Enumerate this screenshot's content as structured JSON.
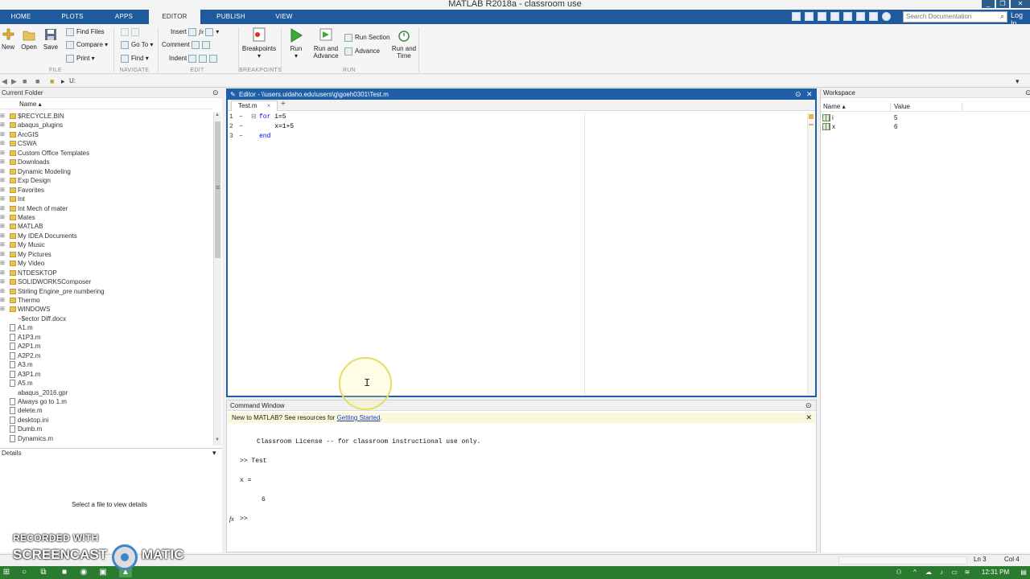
{
  "window": {
    "title": "MATLAB R2018a - classroom use",
    "controls": [
      "_",
      "❐",
      "✕"
    ]
  },
  "ribbon_tabs": [
    {
      "label": "HOME",
      "active": false
    },
    {
      "label": "PLOTS",
      "active": false
    },
    {
      "label": "APPS",
      "active": false
    },
    {
      "label": "EDITOR",
      "active": true
    },
    {
      "label": "PUBLISH",
      "active": false
    },
    {
      "label": "VIEW",
      "active": false
    }
  ],
  "search": {
    "placeholder": "Search Documentation"
  },
  "login_label": "Log In",
  "ribbon": {
    "file": {
      "group": "FILE",
      "new": "New",
      "open": "Open",
      "save": "Save",
      "find_files": "Find Files",
      "compare": "Compare",
      "print": "Print"
    },
    "navigate": {
      "group": "NAVIGATE",
      "goto": "Go To",
      "find": "Find"
    },
    "edit": {
      "group": "EDIT",
      "insert": "Insert",
      "comment": "Comment",
      "indent": "Indent",
      "fx": "fx"
    },
    "breakpoints": {
      "group": "BREAKPOINTS",
      "breakpoints": "Breakpoints"
    },
    "run": {
      "group": "RUN",
      "run": "Run",
      "run_and_advance": "Run and Advance",
      "run_section": "Run Section",
      "advance": "Advance",
      "run_and_time": "Run and Time"
    }
  },
  "address": {
    "path": "U:"
  },
  "current_folder": {
    "title": "Current Folder",
    "column": "Name",
    "items": [
      {
        "name": "$RECYCLE.BIN",
        "type": "folder"
      },
      {
        "name": "abaqus_plugins",
        "type": "folder"
      },
      {
        "name": "ArcGIS",
        "type": "folder"
      },
      {
        "name": "CSWA",
        "type": "folder"
      },
      {
        "name": "Custom Office Templates",
        "type": "folder"
      },
      {
        "name": "Downloads",
        "type": "folder"
      },
      {
        "name": "Dynamic Modeling",
        "type": "folder"
      },
      {
        "name": "Exp Design",
        "type": "folder"
      },
      {
        "name": "Favorites",
        "type": "folder"
      },
      {
        "name": "Int",
        "type": "folder"
      },
      {
        "name": "Int Mech of mater",
        "type": "folder"
      },
      {
        "name": "Mates",
        "type": "folder"
      },
      {
        "name": "MATLAB",
        "type": "folder"
      },
      {
        "name": "My IDEA Documents",
        "type": "folder"
      },
      {
        "name": "My Music",
        "type": "folder"
      },
      {
        "name": "My Pictures",
        "type": "folder"
      },
      {
        "name": "My Video",
        "type": "folder"
      },
      {
        "name": "NTDESKTOP",
        "type": "folder"
      },
      {
        "name": "SOLIDWORKSComposer",
        "type": "folder"
      },
      {
        "name": "Stirling Engine_pre numbering",
        "type": "folder"
      },
      {
        "name": "Thermo",
        "type": "folder"
      },
      {
        "name": "WINDOWS",
        "type": "folder"
      },
      {
        "name": "~$ector Diff.docx",
        "type": "file"
      },
      {
        "name": "A1.m",
        "type": "mfile"
      },
      {
        "name": "A1P3.m",
        "type": "mfile"
      },
      {
        "name": "A2P1.m",
        "type": "mfile"
      },
      {
        "name": "A2P2.m",
        "type": "mfile"
      },
      {
        "name": "A3.m",
        "type": "mfile"
      },
      {
        "name": "A3P1.m",
        "type": "mfile"
      },
      {
        "name": "A5.m",
        "type": "mfile"
      },
      {
        "name": "abaqus_2016.gpr",
        "type": "file"
      },
      {
        "name": "Always go to 1.m",
        "type": "mfile"
      },
      {
        "name": "delete.m",
        "type": "mfile"
      },
      {
        "name": "desktop.ini",
        "type": "mfile"
      },
      {
        "name": "Dumb.m",
        "type": "mfile"
      },
      {
        "name": "Dynamics.m",
        "type": "mfile"
      }
    ]
  },
  "details": {
    "title": "Details",
    "message": "Select a file to view details"
  },
  "editor": {
    "title": "Editor - \\\\users.uidaho.edu\\users\\g\\goeh0301\\Test.m",
    "tabs": [
      {
        "label": "Test.m",
        "close": "×"
      }
    ],
    "add_tab": "+",
    "lines": [
      {
        "num": "1",
        "pre": "",
        "kw": "for",
        "rest": " i=5"
      },
      {
        "num": "2",
        "pre": "    ",
        "kw": "",
        "rest": "x=1+5"
      },
      {
        "num": "3",
        "pre": "",
        "kw": "end",
        "rest": ""
      }
    ]
  },
  "command_window": {
    "title": "Command Window",
    "banner_prefix": "New to MATLAB? See resources for ",
    "banner_link": "Getting Started",
    "banner_suffix": ".",
    "license": "Classroom License -- for classroom instructional use only.",
    "cmd": ">> Test",
    "var_out": "x =",
    "value_out": "6",
    "fx": "fx",
    "prompt": ">>"
  },
  "workspace": {
    "title": "Workspace",
    "col_name": "Name",
    "col_value": "Value",
    "vars": [
      {
        "name": "i",
        "value": "5"
      },
      {
        "name": "x",
        "value": "6"
      }
    ]
  },
  "status": {
    "ln": "Ln 3",
    "col": "Col 4"
  },
  "taskbar": {
    "clock": "12:31 PM"
  },
  "watermark": {
    "line1": "RECORDED WITH",
    "word_a": "SCREENCAST",
    "word_b": "MATIC"
  },
  "colors": {
    "tab_blue": "#1e5a9c",
    "editor_accent": "#1f5fa8",
    "taskbar_green": "#2a7b30",
    "keyword": "#0000ff"
  }
}
